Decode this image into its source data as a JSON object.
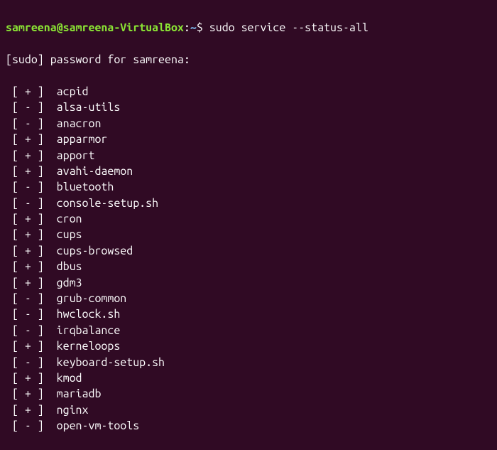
{
  "prompt": {
    "user": "samreena",
    "host": "samreena-VirtualBox",
    "path": "~",
    "symbol": "$"
  },
  "command": "sudo service --status-all",
  "sudo_prompt": "[sudo] password for samreena:",
  "services": [
    {
      "status": "+",
      "name": "acpid"
    },
    {
      "status": "-",
      "name": "alsa-utils"
    },
    {
      "status": "-",
      "name": "anacron"
    },
    {
      "status": "+",
      "name": "apparmor"
    },
    {
      "status": "+",
      "name": "apport"
    },
    {
      "status": "+",
      "name": "avahi-daemon"
    },
    {
      "status": "-",
      "name": "bluetooth"
    },
    {
      "status": "-",
      "name": "console-setup.sh"
    },
    {
      "status": "+",
      "name": "cron"
    },
    {
      "status": "+",
      "name": "cups"
    },
    {
      "status": "+",
      "name": "cups-browsed"
    },
    {
      "status": "+",
      "name": "dbus"
    },
    {
      "status": "+",
      "name": "gdm3"
    },
    {
      "status": "-",
      "name": "grub-common"
    },
    {
      "status": "-",
      "name": "hwclock.sh"
    },
    {
      "status": "-",
      "name": "irqbalance"
    },
    {
      "status": "+",
      "name": "kerneloops"
    },
    {
      "status": "-",
      "name": "keyboard-setup.sh"
    },
    {
      "status": "+",
      "name": "kmod"
    },
    {
      "status": "+",
      "name": "mariadb"
    },
    {
      "status": "+",
      "name": "nginx"
    },
    {
      "status": "-",
      "name": "open-vm-tools"
    }
  ]
}
